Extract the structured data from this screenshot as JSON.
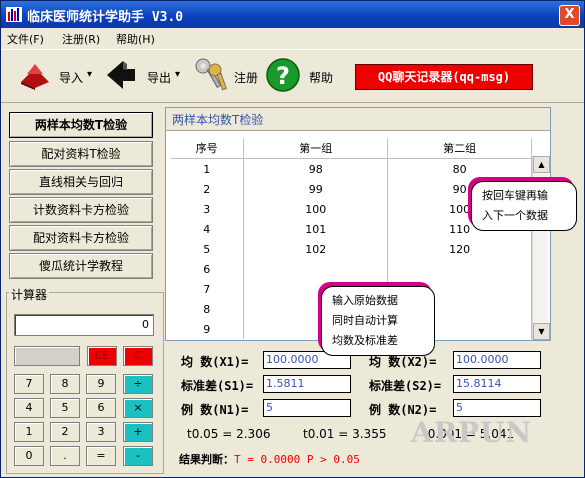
{
  "window": {
    "title": "临床医师统计学助手 V3.0",
    "close_label": "X"
  },
  "menu": [
    {
      "label": "文件(F)"
    },
    {
      "label": "注册(R)"
    },
    {
      "label": "帮助(H)"
    }
  ],
  "toolbar": {
    "import_label": "导入",
    "export_label": "导出",
    "register_label": "注册",
    "help_label": "帮助",
    "qq_label": "QQ聊天记录器(qq-msg)",
    "dropdown_arrow": "▾"
  },
  "nav": [
    {
      "label": "两样本均数T检验",
      "active": true
    },
    {
      "label": "配对资料T检验"
    },
    {
      "label": "直线相关与回归"
    },
    {
      "label": "计数资料卡方检验"
    },
    {
      "label": "配对资料卡方检验"
    },
    {
      "label": "傻瓜统计学教程"
    }
  ],
  "calculator": {
    "label": "计算器",
    "display": "0",
    "keys": {
      "ce": "CE",
      "c": "C",
      "k7": "7",
      "k8": "8",
      "k9": "9",
      "div": "÷",
      "k4": "4",
      "k5": "5",
      "k6": "6",
      "mul": "×",
      "k1": "1",
      "k2": "2",
      "k3": "3",
      "add": "+",
      "k0": "0",
      "dot": ".",
      "eq": "=",
      "sub": "-"
    }
  },
  "panel": {
    "tab_label": "两样本均数T检验",
    "columns": [
      "序号",
      "第一组",
      "第二组"
    ],
    "rows": [
      [
        "1",
        "98",
        "80"
      ],
      [
        "2",
        "99",
        "90"
      ],
      [
        "3",
        "100",
        "100"
      ],
      [
        "4",
        "101",
        "110"
      ],
      [
        "5",
        "102",
        "120"
      ],
      [
        "6",
        "",
        ""
      ],
      [
        "7",
        "",
        ""
      ],
      [
        "8",
        "",
        ""
      ],
      [
        "9",
        "",
        ""
      ]
    ]
  },
  "stats": {
    "mean1_label": "均 数(X1)=",
    "mean1": "100.0000",
    "mean2_label": "均 数(X2)=",
    "mean2": "100.0000",
    "sd1_label": "标准差(S1)=",
    "sd1": "1.5811",
    "sd2_label": "标准差(S2)=",
    "sd2": "15.8114",
    "n1_label": "例 数(N1)=",
    "n1": "5",
    "n2_label": "例 数(N2)=",
    "n2": "5",
    "t005": "t0.05 = 2.306",
    "t001": "t0.01 = 3.355",
    "t0001": "t0.001 = 5.041",
    "result_label": "结果判断：",
    "result_value": "T = 0.0000  P > 0.05"
  },
  "tips": {
    "tip1": [
      "按回车键再输",
      "入下一个数据"
    ],
    "tip2": [
      "输入原始数据",
      "同时自动计算",
      "均数及标准差"
    ]
  },
  "watermark": "ARPUN",
  "colors": {
    "titlebar": "#0a3fb8",
    "qq_button": "#e00000",
    "accent_cyan": "#1bc0c0",
    "field_text": "#3355aa"
  }
}
